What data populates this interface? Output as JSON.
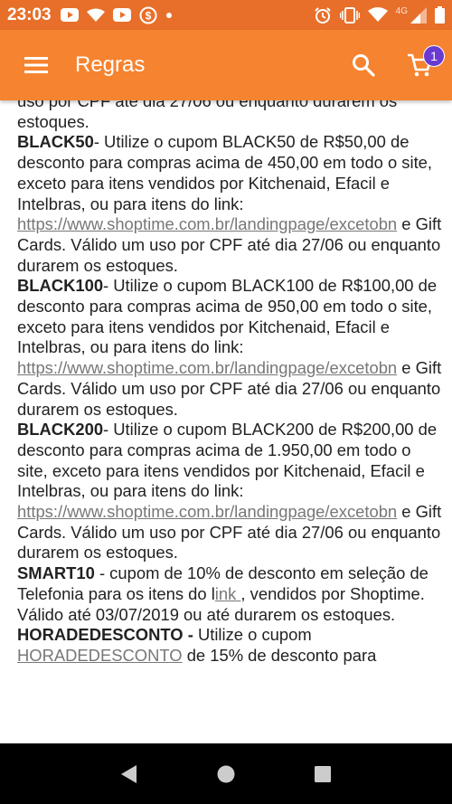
{
  "status_bar": {
    "time": "23:03",
    "network_label": "4G",
    "icons": [
      "youtube-icon",
      "wifi-icon",
      "youtube-icon",
      "dollar-icon",
      "dot-icon",
      "alarm-icon",
      "vibrate-icon",
      "wifi-icon",
      "signal-icon",
      "battery-icon"
    ]
  },
  "app_bar": {
    "title": "Regras",
    "cart_count": "1",
    "colors": {
      "primary": "#f6832f",
      "status": "#e86f2a",
      "badge": "#6a3ad3"
    }
  },
  "rules": [
    {
      "code": "",
      "text": "uso por CPF até dia 27/06 ou enquanto durarem os estoques."
    },
    {
      "code": "BLACK50",
      "text": "- Utilize o cupom BLACK50 de R$50,00 de desconto para compras acima de 450,00 em todo o site, exceto para itens vendidos por Kitchenaid, Efacil e Intelbras, ou para itens do link: ",
      "link": "https://www.shoptime.com.br/landingpage/excetobn",
      "after": " e Gift Cards. Válido um uso por CPF até dia 27/06 ou enquanto durarem os estoques."
    },
    {
      "code": "BLACK100",
      "text": "- Utilize o cupom BLACK100 de R$100,00 de desconto para compras acima de 950,00 em todo o site, exceto para itens vendidos por Kitchenaid, Efacil e Intelbras, ou para itens do link: ",
      "link": "https://www.shoptime.com.br/landingpage/excetobn",
      "after": " e Gift Cards. Válido um uso por CPF até dia 27/06 ou enquanto durarem os estoques."
    },
    {
      "code": "BLACK200",
      "text": "- Utilize o cupom BLACK200 de R$200,00 de desconto para compras acima de 1.950,00 em todo o site, exceto para itens vendidos por Kitchenaid, Efacil e Intelbras, ou para itens do link: ",
      "link": "https://www.shoptime.com.br/landingpage/excetobn",
      "after": " e Gift Cards. Válido um uso por CPF até dia 27/06 ou enquanto durarem os estoques."
    },
    {
      "code": " SMART10",
      "text": " - cupom de 10% de desconto em seleção de Telefonia para os itens do l",
      "link": "ink ",
      "after": ", vendidos por Shoptime. Válido até 03/07/2019 ou até durarem os estoques."
    },
    {
      "code": " HORADEDESCONTO -",
      "text": " Utilize o cupom ",
      "link": "HORADEDESCONTO",
      "after": " de 15% de desconto para"
    }
  ]
}
